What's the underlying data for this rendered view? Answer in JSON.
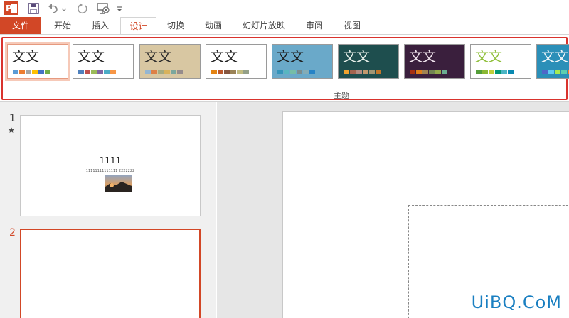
{
  "quick_access": {
    "app_icon": "powerpoint-logo-icon",
    "save_icon": "save-icon",
    "undo_icon": "undo-icon",
    "redo_icon": "redo-icon",
    "start_slideshow_icon": "slideshow-from-beginning-icon",
    "customize_icon": "customize-toolbar-icon"
  },
  "tabs": [
    {
      "label": "文件"
    },
    {
      "label": "开始"
    },
    {
      "label": "插入"
    },
    {
      "label": "设计"
    },
    {
      "label": "切换"
    },
    {
      "label": "动画"
    },
    {
      "label": "幻灯片放映"
    },
    {
      "label": "审阅"
    },
    {
      "label": "视图"
    }
  ],
  "ribbon": {
    "group_label": "主题",
    "themes": [
      {
        "title": "文文",
        "bg": "#ffffff",
        "title_color": "#222222",
        "swatches": [
          "#5b9bd5",
          "#ed7d31",
          "#a5a5a5",
          "#ffc000",
          "#4472c4",
          "#70ad47"
        ]
      },
      {
        "title": "文文",
        "bg": "#ffffff",
        "title_color": "#222222",
        "swatches": [
          "#4f81bd",
          "#c0504d",
          "#9bbb59",
          "#8064a2",
          "#4bacc6",
          "#f79646"
        ]
      },
      {
        "title": "文文",
        "bg": "#d8c7a2",
        "title_color": "#2b2b2b",
        "swatches": [
          "#94b6d2",
          "#dd8047",
          "#a5ab81",
          "#d8b25c",
          "#7ba79d",
          "#968c8c"
        ]
      },
      {
        "title": "文文",
        "bg": "#ffffff",
        "title_color": "#222222",
        "swatches": [
          "#e48312",
          "#bd582c",
          "#865640",
          "#9b8357",
          "#c2bc80",
          "#94a088"
        ]
      },
      {
        "title": "文文",
        "bg": "#6aa9c9",
        "title_color": "#1d1d1d",
        "swatches": [
          "#3494ba",
          "#58b6c0",
          "#75bda7",
          "#7a8c8e",
          "#84acb6",
          "#2683c6"
        ]
      },
      {
        "title": "文文",
        "bg": "#1e4e4e",
        "title_color": "#e8f0ea",
        "swatches": [
          "#f0a22e",
          "#a5644e",
          "#b58b80",
          "#c3986d",
          "#a19574",
          "#c17529"
        ]
      },
      {
        "title": "文文",
        "bg": "#3a1f3d",
        "title_color": "#f2e6ef",
        "swatches": [
          "#a53010",
          "#de7e18",
          "#9f8351",
          "#728653",
          "#92aa4c",
          "#6aac91"
        ]
      },
      {
        "title": "文文",
        "bg": "#ffffff",
        "title_color": "#8fbf3a",
        "swatches": [
          "#549e39",
          "#8ab833",
          "#c0cf3a",
          "#029676",
          "#4ab5c4",
          "#0989b1"
        ]
      },
      {
        "title": "文文",
        "bg": "#2b8fb8",
        "title_color": "#f0f6f9",
        "swatches": [
          "#4e67c8",
          "#5eccf3",
          "#a7ea52",
          "#5dceaf",
          "#ff8021",
          "#f14124"
        ]
      }
    ]
  },
  "slides": [
    {
      "number": "1",
      "has_animation": "★",
      "title": "1111",
      "subtitle": "11111111111111 2222222",
      "image_icon": "sunset-landscape-photo"
    },
    {
      "number": "2"
    }
  ],
  "watermark": "UiBQ.CoM"
}
